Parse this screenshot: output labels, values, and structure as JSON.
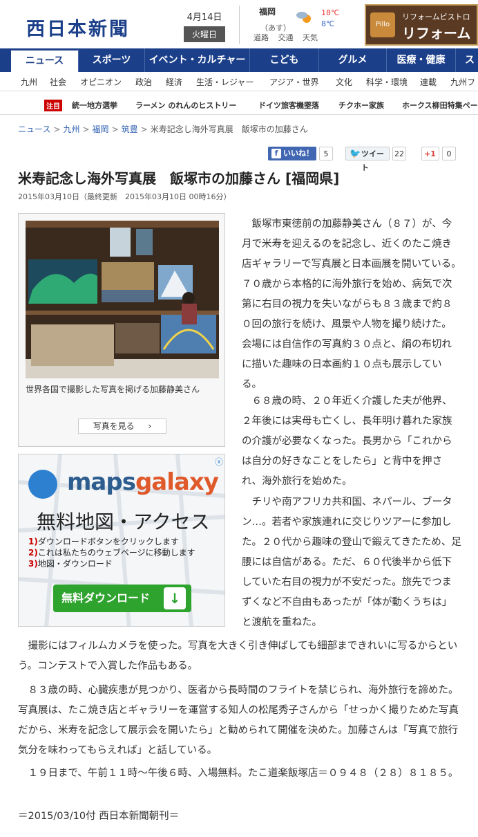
{
  "header": {
    "logo": "西日本新聞",
    "date": "4月14日",
    "weekday": "火曜日",
    "weather": {
      "city": "福岡",
      "tomorrow": "（あす）",
      "high": "18℃",
      "low": "8℃",
      "links": [
        "道路",
        "交通",
        "天気"
      ],
      "icon": "cloud-sun-icon"
    },
    "banner": {
      "top_text": "リフォームビストロ",
      "main_text": "リフォーム",
      "logo": "Pillo"
    }
  },
  "nav": {
    "items": [
      "ニュース",
      "スポーツ",
      "イベント・カルチャー",
      "こども",
      "グルメ",
      "医療・健康",
      "ス"
    ]
  },
  "subnav": {
    "items": [
      "九州",
      "社会",
      "オピニオン",
      "政治",
      "経済",
      "生活・レジャー",
      "アジア・世界",
      "文化",
      "科学・環境",
      "連載",
      "九州フ"
    ]
  },
  "pickup": {
    "label": "注目",
    "items": [
      "統一地方選挙",
      "ラーメン のれんのヒストリー",
      "ドイツ旅客機墜落",
      "チクホー家族",
      "ホークス柳田特集ペー"
    ]
  },
  "breadcrumb": {
    "items": [
      "ニュース",
      "九州",
      "福岡",
      "筑豊"
    ],
    "separator": ">",
    "current": "米寿記念し海外写真展　飯塚市の加藤さん"
  },
  "social": {
    "facebook_label": "いいね！",
    "facebook_count": "5",
    "twitter_label": "ツイート",
    "twitter_count": "22",
    "google_label": "+1",
    "google_count": "0"
  },
  "article": {
    "title": "米寿記念し海外写真展　飯塚市の加藤さん [福岡県]",
    "dateline": "2015年03月10日（最終更新　2015年03月10日 00時16分）",
    "photo_caption": "世界各国で撮影した写真を掲げる加藤静美さん",
    "photo_button": "写真を見る",
    "paragraphs": [
      "飯塚市東徳前の加藤静美さん（８７）が、今月で米寿を迎えるのを記念し、近くのたこ焼き店ギャラリーで写真展と日本画展を開いている。７０歳から本格的に海外旅行を始め、病気で次第に右目の視力を失いながらも８３歳まで約８０回の旅行を続け、風景や人物を撮り続けた。会場には自信作の写真約３０点と、絹の布切れに描いた趣味の日本画約１０点も展示している。",
      "６８歳の時、２０年近く介護した夫が他界、２年後には実母も亡くし、長年明け暮れた家族の介護が必要なくなった。長男から「これからは自分の好きなことをしたら」と背中を押され、海外旅行を始めた。",
      "チリや南アフリカ共和国、ネパール、ブータン…。若者や家族連れに交じりツアーに参加した。２０代から趣味の登山で鍛えてきたため、足腰には自信がある。ただ、６０代後半から低下していた右目の視力が不安だった。旅先でつまずくなど不自由もあったが「体が動くうちは」と渡航を重ねた。",
      "撮影にはフィルムカメラを使った。写真を大きく引き伸ばしても細部まできれいに写るからという。コンテストで入賞した作品もある。",
      "８３歳の時、心臓疾患が見つかり、医者から長時間のフライトを禁じられ、海外旅行を諦めた。写真展は、たこ焼き店とギャラリーを運営する知人の松尾秀子さんから「せっかく撮りためた写真だから、米寿を記念して展示会を開いたら」と勧められて開催を決めた。加藤さんは「写真で旅行気分を味わってもらえれば」と話している。",
      "１９日まで、午前１１時～午後６時、入場無料。たこ道楽飯塚店＝０９４８（２８）８１８５。"
    ],
    "source": "＝2015/03/10付 西日本新聞朝刊＝"
  },
  "ad": {
    "brand_a": "maps",
    "brand_b": "galaxy",
    "title": "無料地図・アクセス",
    "steps": [
      "ダウンロードボタンをクリックします",
      "これは私たちのウェブページに移動します",
      "地図・ダウンロード"
    ],
    "step_numbers": [
      "1)",
      "2)",
      "3)"
    ],
    "cta": "無料ダウンロード",
    "close": "ⓧ"
  },
  "colors": {
    "brand": "#1c3f8a",
    "pickup_label": "#cc0000",
    "link": "#2a5db0"
  }
}
